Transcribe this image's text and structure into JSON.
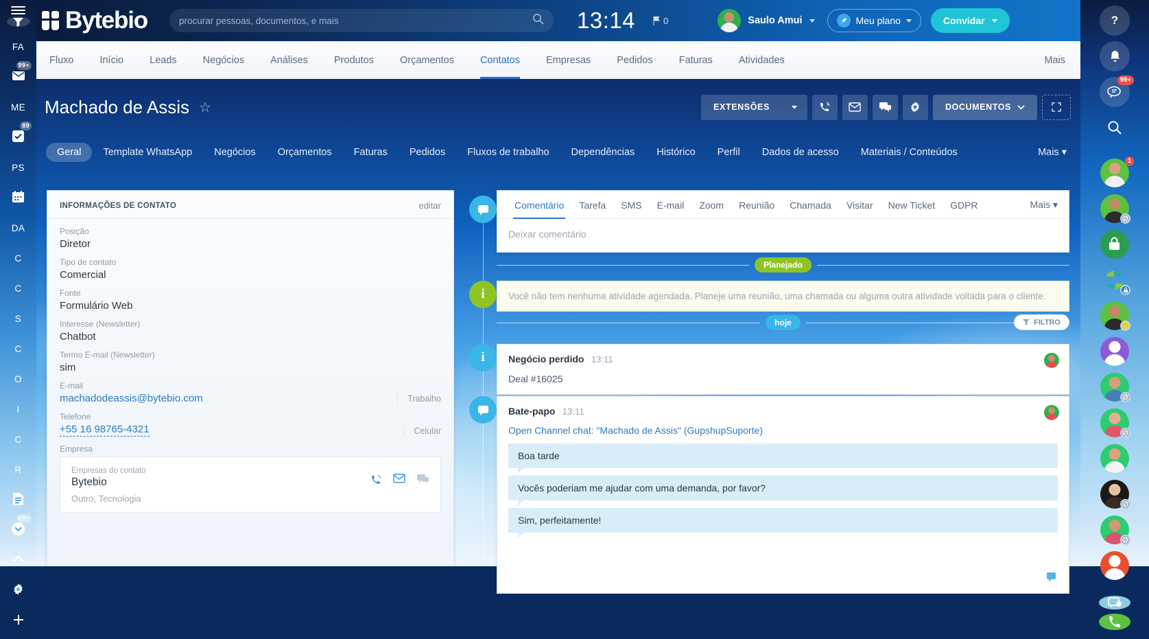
{
  "header": {
    "menu_icon": "hamburger-icon",
    "logo_text": "Bytebio",
    "search_placeholder": "procurar pessoas, documentos, e mais",
    "search_value": "",
    "search_icon": "search-icon",
    "clock": "13:14",
    "flag_icon": "flag-icon",
    "flag_count": "0",
    "user_name": "Saulo Amui",
    "plan_label": "Meu plano",
    "plan_icon": "rocket-icon",
    "invite_label": "Convidar"
  },
  "mainnav": {
    "items": [
      {
        "label": "Fluxo",
        "active": false
      },
      {
        "label": "Início",
        "active": false
      },
      {
        "label": "Leads",
        "active": false
      },
      {
        "label": "Negócios",
        "active": false
      },
      {
        "label": "Análises",
        "active": false
      },
      {
        "label": "Produtos",
        "active": false
      },
      {
        "label": "Orçamentos",
        "active": false
      },
      {
        "label": "Contatos",
        "active": true
      },
      {
        "label": "Empresas",
        "active": false
      },
      {
        "label": "Pedidos",
        "active": false
      },
      {
        "label": "Faturas",
        "active": false
      },
      {
        "label": "Atividades",
        "active": false
      }
    ],
    "more_label": "Mais"
  },
  "titlebar": {
    "title": "Machado de Assis",
    "star_icon": "star-outline-icon",
    "extensions_label": "EXTENSÕES",
    "dropdown_icon": "chevron-down-icon",
    "call_icon": "phone-icon",
    "mail_icon": "envelope-icon",
    "chat_icon": "chat-icon",
    "settings_icon": "gear-icon",
    "documents_label": "DOCUMENTOS",
    "documents_caret_icon": "chevron-down-icon",
    "resize_icon": "expand-icon"
  },
  "enttabs": {
    "items": [
      {
        "label": "Geral",
        "active": true
      },
      {
        "label": "Template WhatsApp",
        "active": false
      },
      {
        "label": "Negócios",
        "active": false
      },
      {
        "label": "Orçamentos",
        "active": false
      },
      {
        "label": "Faturas",
        "active": false
      },
      {
        "label": "Pedidos",
        "active": false
      },
      {
        "label": "Fluxos de trabalho",
        "active": false
      },
      {
        "label": "Dependências",
        "active": false
      },
      {
        "label": "Histórico",
        "active": false
      },
      {
        "label": "Perfil",
        "active": false
      },
      {
        "label": "Dados de acesso",
        "active": false
      },
      {
        "label": "Materiais / Conteúdos",
        "active": false
      }
    ],
    "more_label": "Mais"
  },
  "info_card": {
    "heading": "INFORMAÇÕES DE CONTATO",
    "edit_label": "editar",
    "fields": [
      {
        "label": "Posição",
        "value": "Diretor",
        "side": "",
        "link": false
      },
      {
        "label": "Tipo de contato",
        "value": "Comercial",
        "side": "",
        "link": false
      },
      {
        "label": "Fonte",
        "value": "Formulário Web",
        "side": "",
        "link": false
      },
      {
        "label": "Interesse (Newsletter)",
        "value": "Chatbot",
        "side": "",
        "link": false
      },
      {
        "label": "Termo E-mail (Newsletter)",
        "value": "sim",
        "side": "",
        "link": false
      },
      {
        "label": "E-mail",
        "value": "machadodeassis@bytebio.com",
        "side": "Trabalho",
        "link": true
      },
      {
        "label": "Telefone",
        "value": "+55 16 98765-4321",
        "side": "Celular",
        "link": true
      }
    ],
    "company_label": "Empresa",
    "company": {
      "sub_label": "Empresas do contato",
      "name": "Bytebio",
      "meta": "Outro, Tecnologia",
      "call_icon": "phone-icon",
      "mail_icon": "envelope-icon",
      "chat_icon": "chat-icon"
    }
  },
  "stream": {
    "editor": {
      "icon": "chat-bubble-icon",
      "tabs": [
        {
          "label": "Comentário",
          "active": true
        },
        {
          "label": "Tarefa",
          "active": false
        },
        {
          "label": "SMS",
          "active": false
        },
        {
          "label": "E-mail",
          "active": false
        },
        {
          "label": "Zoom",
          "active": false
        },
        {
          "label": "Reunião",
          "active": false
        },
        {
          "label": "Chamada",
          "active": false
        },
        {
          "label": "Visitar",
          "active": false
        },
        {
          "label": "New Ticket",
          "active": false
        },
        {
          "label": "GDPR",
          "active": false
        }
      ],
      "more_label": "Mais",
      "placeholder": "Deixar comentário"
    },
    "planned_pill": "Planejado",
    "planned_notice": "Você não tem nenhuma atividade agendada. Planeje uma reunião, uma chamada ou alguma outra atividade voltada para o cliente.",
    "planned_icon": "info-icon",
    "today_pill": "hoje",
    "filter_label": "FILTRO",
    "filter_icon": "funnel-icon",
    "entries": [
      {
        "icon": "info-icon",
        "title": "Negócio perdido",
        "time": "13:11",
        "text": "Deal #16025",
        "link": "",
        "messages": []
      },
      {
        "icon": "chat-bubble-icon",
        "title": "Bate-papo",
        "time": "13:11",
        "text": "",
        "link": "Open Channel chat: \"Machado de Assis\" (GupshupSuporte)",
        "messages": [
          "Boa tarde",
          "Vocês poderiam me ajudar com uma demanda, por favor?",
          "Sim, perfeitamente!"
        ]
      }
    ]
  },
  "left_rail": {
    "burger_icon": "hamburger-icon",
    "filter_icon": "funnel-icon",
    "items": [
      {
        "label": "FA",
        "icon": "",
        "badge": ""
      },
      {
        "label": "",
        "icon": "envelope-icon",
        "badge": "99+"
      },
      {
        "label": "ME",
        "icon": "",
        "badge": ""
      },
      {
        "label": "",
        "icon": "task-check-icon",
        "badge": "89"
      },
      {
        "label": "PS",
        "icon": "",
        "badge": ""
      },
      {
        "label": "",
        "icon": "calendar-icon",
        "badge": ""
      },
      {
        "label": "DA",
        "icon": "",
        "badge": ""
      },
      {
        "label": "C",
        "icon": "",
        "badge": ""
      },
      {
        "label": "C",
        "icon": "",
        "badge": ""
      },
      {
        "label": "S",
        "icon": "",
        "badge": ""
      },
      {
        "label": "C",
        "icon": "",
        "badge": ""
      },
      {
        "label": "O",
        "icon": "",
        "badge": ""
      },
      {
        "label": "I",
        "icon": "",
        "badge": ""
      },
      {
        "label": "C",
        "icon": "",
        "badge": ""
      },
      {
        "label": "R",
        "icon": "",
        "badge": ""
      },
      {
        "label": "",
        "icon": "document-icon",
        "badge": ""
      },
      {
        "label": "",
        "icon": "chevron-down-circle-icon",
        "badge": "99+"
      },
      {
        "label": "",
        "icon": "chevron-up-icon",
        "badge": ""
      },
      {
        "label": "",
        "icon": "gear-icon",
        "badge": ""
      },
      {
        "label": "",
        "icon": "plus-icon",
        "badge": ""
      }
    ]
  },
  "right_rail": {
    "help_icon": "question-mark-icon",
    "bell_icon": "bell-icon",
    "messages_icon": "messages-icon",
    "messages_badge": "99+",
    "search_icon": "search-icon",
    "contacts": [
      {
        "icon": "avatar",
        "face": "#d8a47f",
        "body": "#f0f0f0",
        "ring": "#5cc23f",
        "badge": "1",
        "status": ""
      },
      {
        "icon": "avatar",
        "face": "#c08a62",
        "body": "#2b2b2b",
        "ring": "#5cc23f",
        "badge": "",
        "status": "off"
      },
      {
        "icon": "lock-icon",
        "face": "",
        "body": "",
        "ring": "#2a9d52",
        "badge": "",
        "status": ""
      },
      {
        "icon": "group-icon",
        "face": "",
        "body": "",
        "ring": "",
        "badge": "",
        "status": "b"
      },
      {
        "icon": "avatar",
        "face": "#c08a62",
        "body": "#2b2b2b",
        "ring": "#5cc23f",
        "badge": "",
        "status": "y"
      },
      {
        "icon": "person-icon",
        "face": "",
        "body": "",
        "ring": "#8b5cd6",
        "badge": "",
        "status": ""
      },
      {
        "icon": "avatar",
        "face": "#d2a07a",
        "body": "#4a7fb5",
        "ring": "#2ecc71",
        "badge": "",
        "status": "off"
      },
      {
        "icon": "avatar",
        "face": "#e0b090",
        "body": "#e0566a",
        "ring": "#2ecc71",
        "badge": "",
        "status": "off"
      },
      {
        "icon": "avatar",
        "face": "#d8a47f",
        "body": "#f5f5f5",
        "ring": "#2ecc71",
        "badge": "",
        "status": ""
      },
      {
        "icon": "avatar",
        "face": "#e8c2a0",
        "body": "#3a2a22",
        "ring": "#1a1a1a",
        "badge": "",
        "status": "off"
      },
      {
        "icon": "avatar",
        "face": "#d09a72",
        "body": "#d8556e",
        "ring": "#2ecc71",
        "badge": "",
        "status": "off"
      },
      {
        "icon": "person-icon",
        "face": "",
        "body": "",
        "ring": "#e8502d",
        "badge": "",
        "status": ""
      }
    ],
    "open_channel_icon": "open-channel-icon",
    "phone_icon": "phone-icon"
  }
}
